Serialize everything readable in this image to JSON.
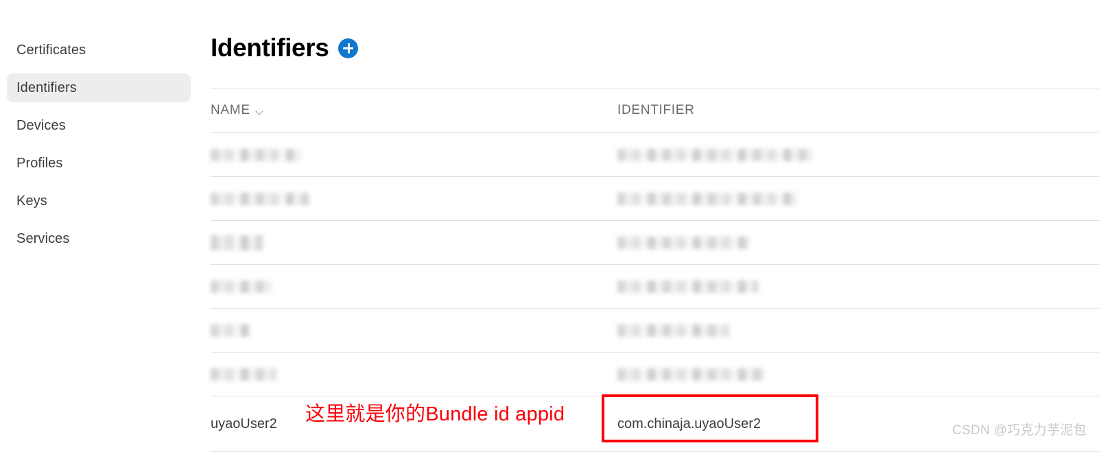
{
  "sidebar": {
    "items": [
      {
        "label": "Certificates",
        "selected": false
      },
      {
        "label": "Identifiers",
        "selected": true
      },
      {
        "label": "Devices",
        "selected": false
      },
      {
        "label": "Profiles",
        "selected": false
      },
      {
        "label": "Keys",
        "selected": false
      },
      {
        "label": "Services",
        "selected": false
      }
    ]
  },
  "header": {
    "title": "Identifiers",
    "add_button_icon": "plus-icon",
    "add_button_color": "#1177cf"
  },
  "table": {
    "columns": [
      {
        "key": "name",
        "label": "NAME",
        "sortable": true,
        "sort_icon": "chevron-down-icon"
      },
      {
        "key": "identifier",
        "label": "IDENTIFIER",
        "sortable": false,
        "sort_icon": ""
      }
    ],
    "rows": [
      {
        "name": "",
        "identifier": "",
        "name_redacted": true,
        "identifier_redacted": true,
        "name_width": 132,
        "identifier_width": 285,
        "highlighted": false
      },
      {
        "name": "",
        "identifier": "",
        "name_redacted": true,
        "identifier_redacted": true,
        "name_width": 144,
        "identifier_width": 262,
        "highlighted": false
      },
      {
        "name": "",
        "identifier": "",
        "name_redacted": true,
        "identifier_redacted": true,
        "name_width": 76,
        "identifier_width": 193,
        "highlighted": false
      },
      {
        "name": "",
        "identifier": "",
        "name_redacted": true,
        "identifier_redacted": true,
        "name_width": 88,
        "identifier_width": 205,
        "highlighted": false
      },
      {
        "name": "",
        "identifier": "",
        "name_redacted": true,
        "identifier_redacted": true,
        "name_width": 58,
        "identifier_width": 163,
        "highlighted": false
      },
      {
        "name": "",
        "identifier": "",
        "name_redacted": true,
        "identifier_redacted": true,
        "name_width": 96,
        "identifier_width": 214,
        "highlighted": false
      },
      {
        "name": "uyaoUser2",
        "identifier": "com.chinaja.uyaoUser2",
        "name_redacted": false,
        "identifier_redacted": false,
        "name_width": 0,
        "identifier_width": 0,
        "highlighted": true
      }
    ]
  },
  "annotations": {
    "bundle_id_note": "这里就是你的Bundle id appid",
    "color": "#fb0007"
  },
  "watermark": {
    "text": "CSDN @巧克力芋泥包"
  }
}
